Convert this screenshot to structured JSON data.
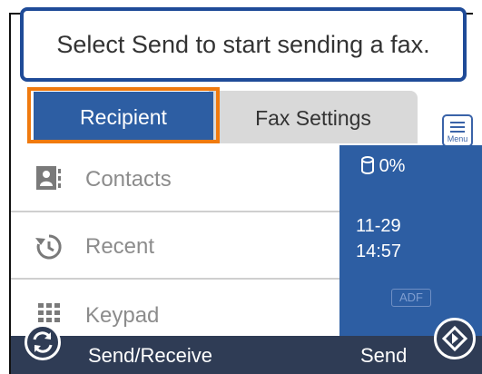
{
  "message": "Select Send to start sending a fax.",
  "tabs": [
    {
      "label": "Recipient",
      "selected": true
    },
    {
      "label": "Fax Settings",
      "selected": false
    }
  ],
  "menu": {
    "label": "Menu",
    "icon": "menu-icon"
  },
  "list": [
    {
      "label": "Contacts",
      "icon": "contacts-icon"
    },
    {
      "label": "Recent",
      "icon": "recent-icon"
    },
    {
      "label": "Keypad",
      "icon": "keypad-icon"
    }
  ],
  "status": {
    "memory": "0%",
    "memory_icon": "memory-icon",
    "date": "11-29",
    "time": "14:57",
    "adf": "ADF"
  },
  "bottom": {
    "send_receive_label": "Send/Receive",
    "send_label": "Send"
  },
  "colors": {
    "primary_blue": "#2d5ea3",
    "highlight_orange": "#f07a0e",
    "bottom_bar": "#2f3c55"
  }
}
